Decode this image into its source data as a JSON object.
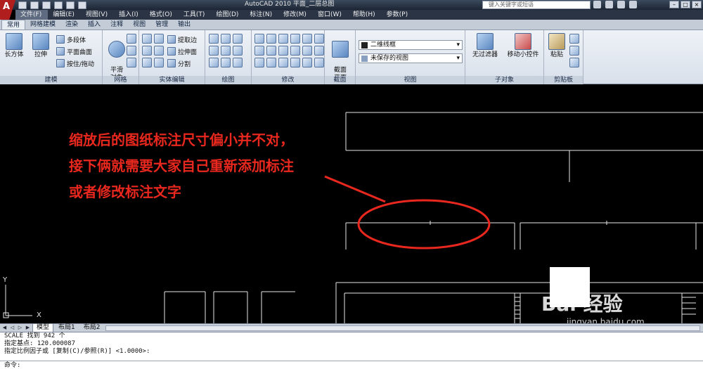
{
  "window": {
    "app_logo": "A",
    "title": "AutoCAD 2010    平面_二层总图",
    "search_placeholder": "键入关键字或短语"
  },
  "menu": [
    "文件(F)",
    "编辑(E)",
    "视图(V)",
    "插入(I)",
    "格式(O)",
    "工具(T)",
    "绘图(D)",
    "标注(N)",
    "修改(M)",
    "窗口(W)",
    "帮助(H)",
    "参数(P)"
  ],
  "ribbon_tabs": [
    "常用",
    "网格建模",
    "渲染",
    "插入",
    "注释",
    "视图",
    "管理",
    "输出"
  ],
  "ribbon": {
    "modeling": {
      "title": "建模",
      "box_label": "长方体",
      "extrude_label": "拉伸",
      "polysolid": "多段体",
      "planar_surface": "平面曲面",
      "presspull": "按住/拖动"
    },
    "mesh": {
      "title": "网格",
      "smooth_label": "平滑\n对象"
    },
    "solid_edit": {
      "title": "实体编辑",
      "extract_edges": "提取边",
      "extrude_faces": "拉伸面",
      "separate": "分割"
    },
    "draw": {
      "title": "绘图"
    },
    "modify": {
      "title": "修改"
    },
    "section": {
      "title": "截面",
      "section_plane": "截面\n平面"
    },
    "view": {
      "title": "视图",
      "visual_style": "二维线框",
      "saved_view": "未保存的视图"
    },
    "subobject": {
      "title": "子对象",
      "no_filter": "无过滤器",
      "move_gizmo": "移动小控件"
    },
    "clipboard": {
      "title": "剪贴板",
      "paste": "粘贴"
    }
  },
  "annotation": {
    "line1": "缩放后的图纸标注尺寸偏小并不对，",
    "line2": "接下俩就需要大家自己重新添加标注",
    "line3": "或者修改标注文字",
    "color": "#e8281e"
  },
  "ucs": {
    "y_label": "Y",
    "x_label": "X"
  },
  "watermark": {
    "brand": "Bai 经验",
    "url": "jingyan.baidu.com"
  },
  "layout_tabs": [
    "模型",
    "布局1",
    "布局2"
  ],
  "command": {
    "history": [
      "SCALE 找到 942 个",
      "指定基点: 120.000087",
      "指定比例因子或 [复制(C)/参照(R)] <1.0000>:"
    ],
    "prompt": "命令:"
  }
}
